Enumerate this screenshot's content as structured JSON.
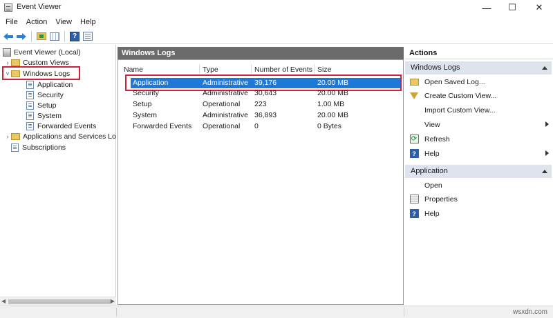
{
  "window": {
    "title": "Event Viewer",
    "minimize": "—",
    "maximize": "☐",
    "close": "✕"
  },
  "menu": [
    "File",
    "Action",
    "View",
    "Help"
  ],
  "tree": {
    "root": "Event Viewer (Local)",
    "custom_views": "Custom Views",
    "windows_logs": "Windows Logs",
    "windows_logs_children": [
      "Application",
      "Security",
      "Setup",
      "System",
      "Forwarded Events"
    ],
    "apps_services": "Applications and Services Lo",
    "subscriptions": "Subscriptions"
  },
  "center": {
    "header": "Windows Logs",
    "columns": [
      "Name",
      "Type",
      "Number of Events",
      "Size"
    ],
    "rows": [
      {
        "name": "Application",
        "type": "Administrative",
        "events": "39,176",
        "size": "20.00 MB"
      },
      {
        "name": "Security",
        "type": "Administrative",
        "events": "30,643",
        "size": "20.00 MB"
      },
      {
        "name": "Setup",
        "type": "Operational",
        "events": "223",
        "size": "1.00 MB"
      },
      {
        "name": "System",
        "type": "Administrative",
        "events": "36,893",
        "size": "20.00 MB"
      },
      {
        "name": "Forwarded Events",
        "type": "Operational",
        "events": "0",
        "size": "0 Bytes"
      }
    ]
  },
  "actions": {
    "title": "Actions",
    "section1": "Windows Logs",
    "section1_items": [
      "Open Saved Log...",
      "Create Custom View...",
      "Import Custom View...",
      "View",
      "Refresh",
      "Help"
    ],
    "section2": "Application",
    "section2_items": [
      "Open",
      "Properties",
      "Help"
    ]
  },
  "status": {
    "watermark": "wsxdn.com"
  },
  "colors": {
    "selection": "#1e78d7",
    "highlight_box": "#d0213a",
    "pane_header": "#6b6b6b",
    "section_header": "#dde4ee"
  }
}
